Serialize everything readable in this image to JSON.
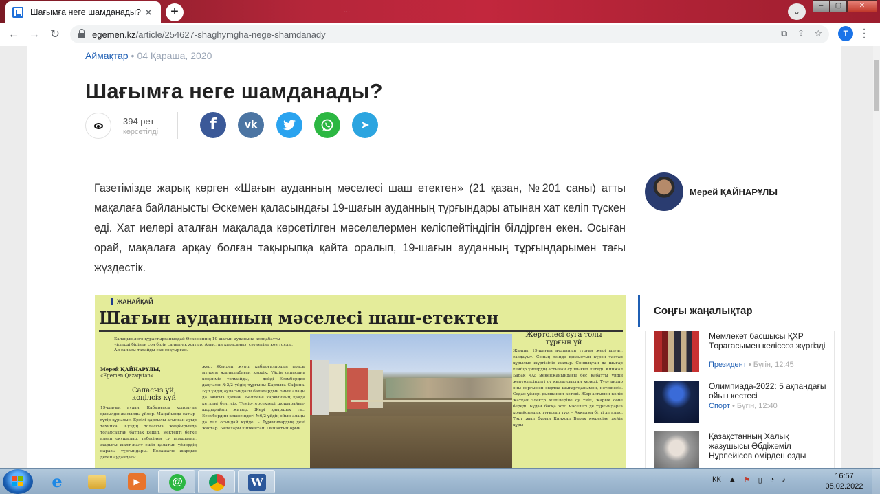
{
  "browser": {
    "tab_title": "Шағымға неге шамданады?",
    "tab_close": "✕",
    "new_tab": "+",
    "background_title": "...",
    "url_host": "egemen.kz",
    "url_path": "/article/254627-shaghymgha-nege-shamdanady",
    "profile_initial": "T",
    "window_buttons": {
      "minimize": "–",
      "maximize": "▢",
      "close": "✕"
    }
  },
  "article": {
    "category": "Аймақтар",
    "separator": "•",
    "date": "04 Қараша, 2020",
    "title": "Шағымға неге шамданады?",
    "views_count": "394 рет",
    "views_label": "көрсетілді",
    "share": {
      "facebook": "f",
      "vk": "vk",
      "twitter": "t",
      "whatsapp": "w",
      "telegram": "➤"
    },
    "lead": "Газетімізде жарық көрген «Шағын ауданның мәселесі шаш етектен» (21 қазан, №201 саны) атты мақалаға байланысты Өскемен қаласындағы 19-шағын ауданның тұрғындары атынан хат келіп түскен еді. Хат иелері аталған мақалада көрсетілген мәселелермен келіспейтіндігін білдірген екен. Осыған орай, мақалаға арқау болған тақырыпқа қайта оралып, 19-шағын ауданның тұрғындарымен тағы жүздестік.",
    "author": "Мерей ҚАЙНАРҰЛЫ"
  },
  "clipping": {
    "section": "ЖАНАЙҚАЙ",
    "title": "Шағын ауданның мәселесі шаш-етектен",
    "intro": "Балаңын,лего құрастырғанындай Өскеменнің 19-шағын ауданына көпқабатты үйлерді бірінен соң бірін салып-ақ жатыр. Алыстан қарасаңыз, сәулетіне көз тоялы. Ал сапасы талайды сан соқтырған.",
    "author_name": "Мерей ҚАЙНАРҰЛЫ,",
    "author_org": "«Egemen Qazaqstan»",
    "subhead1": "Сапасыз үй, көңілсіз күй",
    "subhead2": "Жертөлесі суға толы тұрғын үй",
    "col1": "19-шағын аудан. Қабырғасы қопсыған қызылды-жасылды үйлер. Маңайында сатыр-гүтір құрылыс. Ерсілі-қарсылы ағылған ауыр техника. Күздің толассыз жаңбырында толарсақтан батпақ кешіп, мектепті бетке алған оқушылар, төбесінен су тамшылап, жарығы жалт-жалт өшіп қалатын үйлердің наразы тұрғындары. Болашағы жарқын деген аудандағы",
    "col2": "жүр. Жөндеп жүріп қабырғалардың арасы мүлдем жылылыбаған көрдік. Үйдің сапасына көңіліміз толмайды, – дейді Есембердин даңғылы №2/2 үйдің тұрғыны Карлыға Сафина. Бұл үйдің ауласындағы балалардың ойын алаңы да аяңсыз қалған. Бөлігене карқынның қайда кеткені белгісіз. Темір-терсектері шошырайып-шодырайып жатыр. Жері қиыршық тас. Есембердин көшесіндегі №6/2 үйдің ойын алаңы да дәл осындай күйде. – Тұрғындардың дені жастар. Балалары кішкентай. Ойнайтын орын",
    "col3": "Жалпы, 19-шағын ауданның тұрған жері ылғал, саздауыт. Соның өзінде қымыстың күрен тастап құрылыс жүргізіліп жатыр. Сондықтан да шығар кейбір үйлердің астынан су шығып кетеді. Кинжал Барак 4/2 мекенжайындағы бес қабатты үйдің жертөлесіндегі су қызылсыктан келеді. Тұрғындар оны сорғымен сыртқа шығартқанымен, нәтижесіз. Содан үйлері дымданып кетеді. Жер астымен келіп жатқан электр желілеріне су тиіп, жарық сөне береді. Бұдан басқа жол мәселесі де тұрғындарға қолайсыздық туғызып тұр. – Аккаяма бітті де алыс. Төрт жыл бұрын Кинжал Барак көшесіне дейін құры-"
  },
  "sidebar": {
    "header": "Соңғы жаңалықтар",
    "items": [
      {
        "title": "Мемлекет басшысы ҚХР Төрағасымен келіссөз жүргізді",
        "category": "Президент",
        "time": "Бүгін, 12:45"
      },
      {
        "title": "Олимпиада-2022: 5 ақпандағы ойын кестесі",
        "category": "Спорт",
        "time": "Бүгін, 12:40"
      },
      {
        "title": "Қазақстанның Халық жазушысы Әбдіжәміл Нұрпейісов өмірден озды",
        "category": "",
        "time": ""
      }
    ]
  },
  "taskbar": {
    "apps": [
      "e",
      "",
      "▶",
      "@",
      "",
      "W"
    ],
    "tray": [
      "КК",
      "▲",
      "⚑",
      "▯",
      "◔",
      "♪"
    ],
    "time": "16:57",
    "date": "05.02.2022"
  },
  "colors": {
    "titlebar": "#b5263a",
    "accent_blue": "#1f5fb4",
    "clipping_bg": "#e4ec9a",
    "facebook": "#3b5998",
    "vk": "#4c75a3",
    "twitter": "#2aa3ef",
    "whatsapp": "#2cb742",
    "telegram": "#2ca5e0"
  }
}
